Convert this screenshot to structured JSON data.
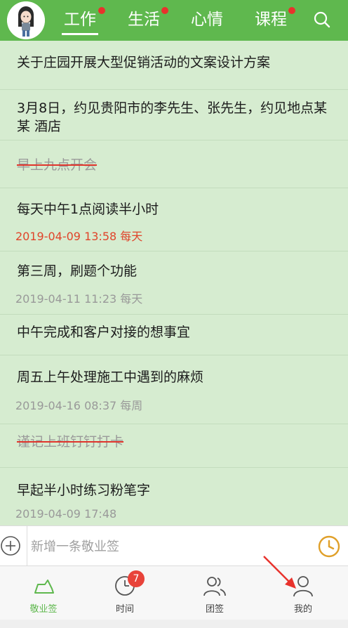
{
  "header": {
    "tabs": [
      {
        "label": "工作",
        "active": true,
        "has_dot": true
      },
      {
        "label": "生活",
        "active": false,
        "has_dot": true
      },
      {
        "label": "心情",
        "active": false,
        "has_dot": false
      },
      {
        "label": "课程",
        "active": false,
        "has_dot": true
      }
    ],
    "search_icon": "search-icon",
    "avatar_icon": "avatar"
  },
  "list": {
    "items": [
      {
        "title": "关于庄园开展大型促销活动的文案设计方案",
        "done": false,
        "meta": ""
      },
      {
        "title": "3月8日，约见贵阳市的李先生、张先生，约见地点某某 酒店",
        "done": false,
        "meta": ""
      },
      {
        "title": "早上九点开会",
        "done": true,
        "meta": ""
      },
      {
        "title": "每天中午1点阅读半小时",
        "done": false,
        "meta": "2019-04-09 13:58  每天",
        "meta_alert": true
      },
      {
        "title": "第三周，刷题个功能",
        "done": false,
        "meta": "2019-04-11 11:23  每天",
        "meta_alert": false
      },
      {
        "title": "中午完成和客户对接的想事宜",
        "done": false,
        "meta": ""
      },
      {
        "title": "周五上午处理施工中遇到的麻烦",
        "done": false,
        "meta": "2019-04-16 08:37  每周",
        "meta_alert": false
      },
      {
        "title": "谨记上班钉钉打卡",
        "done": true,
        "meta": ""
      },
      {
        "title": "早起半小时练习粉笔字",
        "done": false,
        "meta": "2019-04-09 17:48",
        "meta_alert": false
      }
    ]
  },
  "input_bar": {
    "placeholder": "新增一条敬业签",
    "add_icon": "plus-circle-icon",
    "clock_icon": "clock-icon"
  },
  "bottom_nav": {
    "items": [
      {
        "label": "敬业签",
        "icon": "cloud-icon",
        "active": true
      },
      {
        "label": "时间",
        "icon": "clock-icon",
        "active": false,
        "badge": "7"
      },
      {
        "label": "团签",
        "icon": "group-icon",
        "active": false
      },
      {
        "label": "我的",
        "icon": "person-icon",
        "active": false
      }
    ]
  },
  "colors": {
    "primary_green": "#5fb84e",
    "list_background": "#d6ecd0",
    "alert_red": "#e0442a",
    "meta_gray": "#999999",
    "badge_red": "#e8433a"
  }
}
